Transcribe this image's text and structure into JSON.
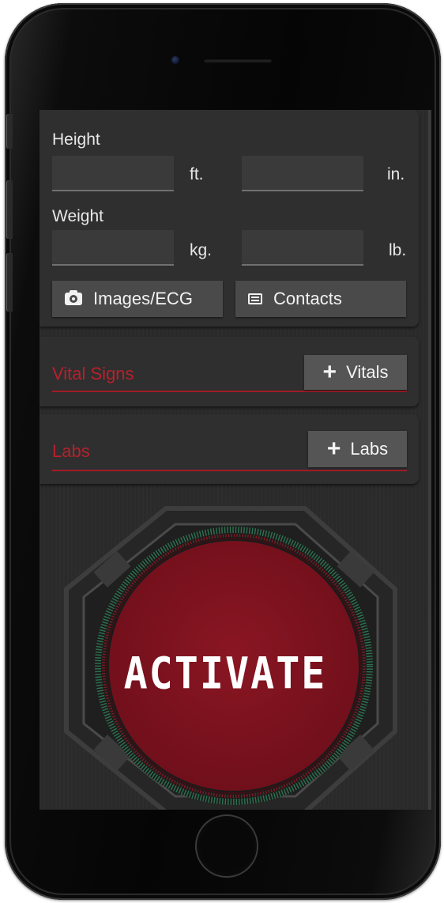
{
  "form": {
    "height_label": "Height",
    "height_ft_value": "",
    "height_ft_unit": "ft.",
    "height_in_value": "",
    "height_in_unit": "in.",
    "weight_label": "Weight",
    "weight_kg_value": "",
    "weight_kg_unit": "kg.",
    "weight_lb_value": "",
    "weight_lb_unit": "lb."
  },
  "buttons": {
    "images_ecg": {
      "label": "Images/ECG",
      "icon": "camera-icon"
    },
    "contacts": {
      "label": "Contacts",
      "icon": "list-icon"
    }
  },
  "sections": {
    "vitals": {
      "title": "Vital Signs",
      "add_label": "Vitals",
      "add_icon": "plus-icon"
    },
    "labs": {
      "title": "Labs",
      "add_label": "Labs",
      "add_icon": "plus-icon"
    }
  },
  "activate": {
    "label": "ACTIVATE"
  },
  "colors": {
    "accent_red": "#b8202c",
    "activate_fill": "#7f1320",
    "dial_ring": "#2e6f4f",
    "panel_bg": "#2f2f2f",
    "button_bg": "#4a4a4a"
  }
}
